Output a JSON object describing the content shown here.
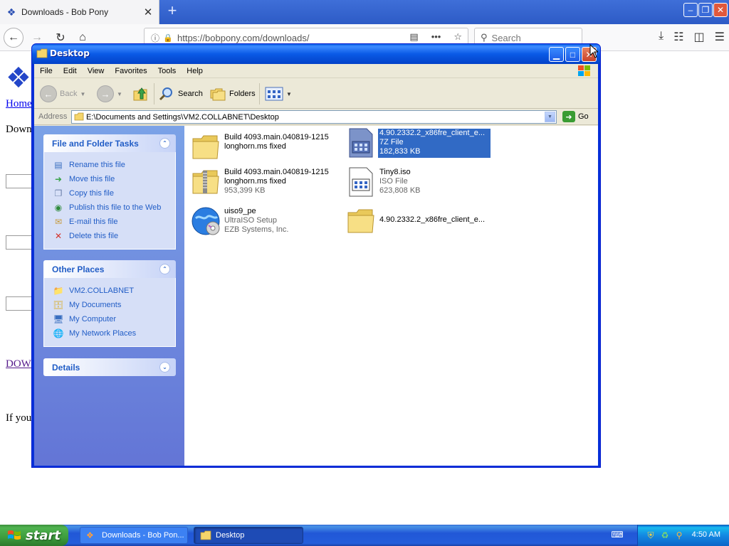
{
  "browser": {
    "tab_title": "Downloads - Bob Pony",
    "tab_close": "✕",
    "new_tab": "+",
    "url": "https://bobpony.com/downloads/",
    "search_placeholder": "Search"
  },
  "page": {
    "home_link": "Home",
    "down_text": "Down",
    "dow_link": "DOW",
    "if_you_text": "If you"
  },
  "explorer": {
    "title": "Desktop",
    "menu": [
      "File",
      "Edit",
      "View",
      "Favorites",
      "Tools",
      "Help"
    ],
    "toolbar": {
      "back": "Back",
      "search": "Search",
      "folders": "Folders"
    },
    "address": {
      "label": "Address",
      "value": "E:\\Documents and Settings\\VM2.COLLABNET\\Desktop",
      "go": "Go"
    },
    "file_tasks": {
      "title": "File and Folder Tasks",
      "items": [
        "Rename this file",
        "Move this file",
        "Copy this file",
        "Publish this file to the Web",
        "E-mail this file",
        "Delete this file"
      ]
    },
    "other_places": {
      "title": "Other Places",
      "items": [
        "VM2.COLLABNET",
        "My Documents",
        "My Computer",
        "My Network Places"
      ]
    },
    "details": {
      "title": "Details"
    },
    "files": [
      {
        "l1": "Build 4093.main.040819-1215",
        "l2": "longhorn.ms fixed",
        "l3": "",
        "icon": "folder-icon",
        "selected": false
      },
      {
        "l1": "4.90.2332.2_x86fre_client_e...",
        "l2": "7Z File",
        "l3": "182,833 KB",
        "icon": "7z-file-icon",
        "selected": true
      },
      {
        "l1": "Build 4093.main.040819-1215",
        "l2": "longhorn.ms fixed",
        "l3": "953,399 KB",
        "icon": "zip-folder-icon",
        "selected": false
      },
      {
        "l1": "Tiny8.iso",
        "l2": "ISO File",
        "l3": "623,808 KB",
        "icon": "iso-file-icon",
        "selected": false
      },
      {
        "l1": "uiso9_pe",
        "l2": "UltraISO Setup",
        "l3": "EZB Systems, Inc.",
        "icon": "setup-globe-icon",
        "selected": false
      },
      {
        "l1": "4.90.2332.2_x86fre_client_e...",
        "l2": "",
        "l3": "",
        "icon": "folder-icon",
        "selected": false
      }
    ]
  },
  "taskbar": {
    "start": "start",
    "tasks": [
      "Downloads - Bob Pon...",
      "Desktop"
    ],
    "clock": "4:50 AM"
  },
  "colors": {
    "xp_title_blue": "#0a5ae6",
    "selection": "#316ac5",
    "task_link": "#215dc6",
    "start_green": "#3d9c3d"
  }
}
